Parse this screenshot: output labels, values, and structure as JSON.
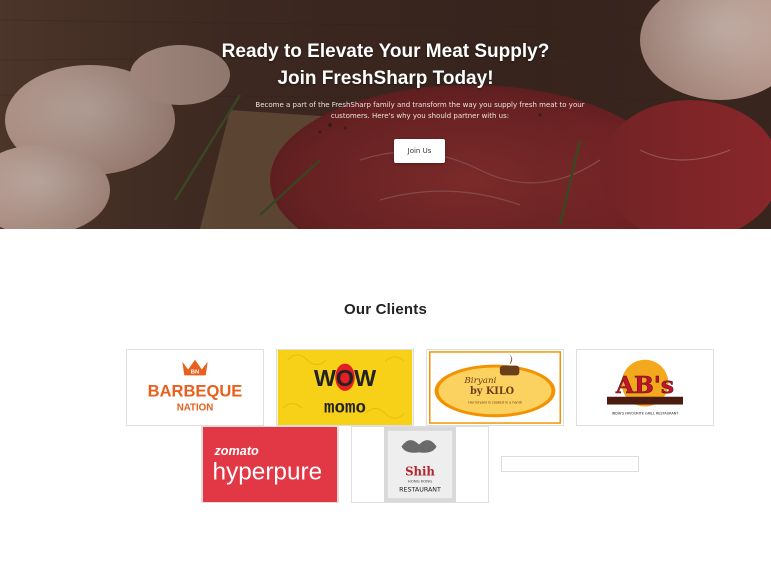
{
  "hero": {
    "title_line1": "Ready to Elevate Your Meat Supply?",
    "title_line2": "Join FreshSharp Today!",
    "subtitle": "Become a part of the FreshSharp family and transform the way you supply fresh meat to your customers. Here's why you should partner with us:",
    "button_label": "Join Us"
  },
  "clients": {
    "title": "Our Clients",
    "logos": [
      {
        "brand_line1": "BARBEQUE",
        "brand_line2": "NATION",
        "badge": "BN",
        "color": "#e8601c"
      },
      {
        "brand_line1": "WOW",
        "brand_line2": "momo",
        "color": "#f7d117",
        "accent": "#e31e24"
      },
      {
        "brand_line1": "Biryani",
        "brand_line2": "by KILO",
        "tagline": "Har biryani is cooked in a handi",
        "color": "#f39200"
      },
      {
        "brand_line1": "AB's",
        "tagline": "INDIA'S FAVOURITE GRILL RESTAURANT",
        "color": "#c8102e"
      },
      {
        "brand_line1": "zomato",
        "brand_line2": "hyperpure",
        "color": "#e23744"
      },
      {
        "brand_line1": "Shih",
        "brand_line2": "RESTAURANT",
        "sub": "HONG KONG",
        "color": "#5a5a5a"
      }
    ]
  }
}
